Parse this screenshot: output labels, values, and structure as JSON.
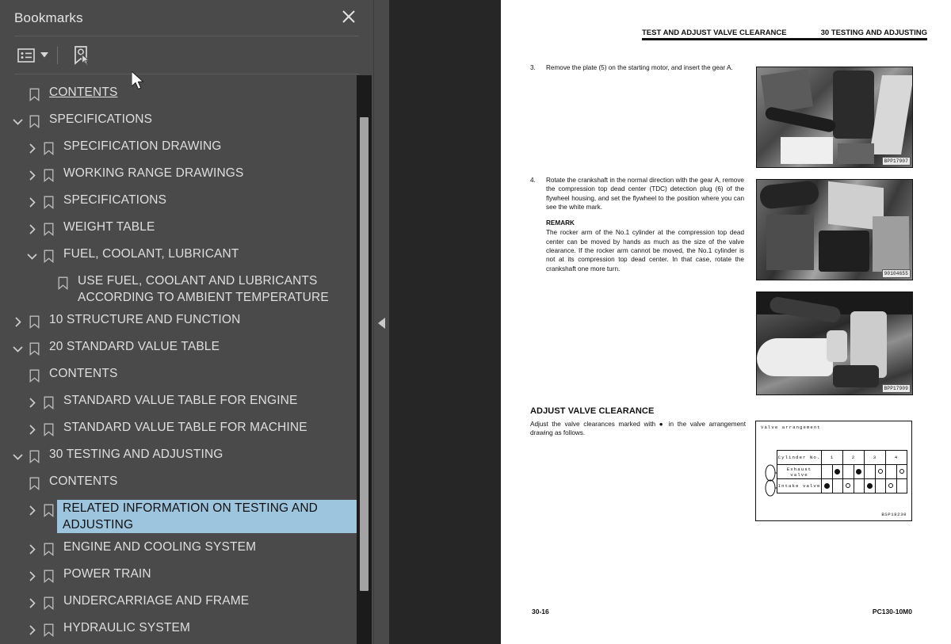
{
  "panel": {
    "title": "Bookmarks",
    "close_label": "Close",
    "toolbar": {
      "options_icon": "list-options-icon",
      "caret_icon": "chevron-down-icon",
      "new_bookmark_icon": "new-bookmark-icon"
    }
  },
  "tree": [
    {
      "label": "CONTENTS",
      "level": 1,
      "twisty": "none",
      "link": true,
      "selected": false
    },
    {
      "label": "SPECIFICATIONS",
      "level": 1,
      "twisty": "expanded",
      "link": false,
      "selected": false
    },
    {
      "label": "SPECIFICATION DRAWING",
      "level": 2,
      "twisty": "collapsed",
      "link": false,
      "selected": false
    },
    {
      "label": "WORKING RANGE DRAWINGS",
      "level": 2,
      "twisty": "collapsed",
      "link": false,
      "selected": false
    },
    {
      "label": "SPECIFICATIONS",
      "level": 2,
      "twisty": "collapsed",
      "link": false,
      "selected": false
    },
    {
      "label": "WEIGHT TABLE",
      "level": 2,
      "twisty": "collapsed",
      "link": false,
      "selected": false
    },
    {
      "label": "FUEL, COOLANT, LUBRICANT",
      "level": 2,
      "twisty": "expanded",
      "link": false,
      "selected": false
    },
    {
      "label": "USE FUEL, COOLANT AND LUBRICANTS ACCORDING TO AMBIENT TEMPERATURE",
      "level": 3,
      "twisty": "none",
      "link": false,
      "selected": false
    },
    {
      "label": "10 STRUCTURE AND FUNCTION",
      "level": 0,
      "twisty": "collapsed",
      "link": false,
      "selected": false
    },
    {
      "label": "20 STANDARD VALUE TABLE",
      "level": 0,
      "twisty": "expanded",
      "link": false,
      "selected": false
    },
    {
      "label": "CONTENTS",
      "level": 1,
      "twisty": "none",
      "link": false,
      "selected": false
    },
    {
      "label": "STANDARD VALUE TABLE FOR ENGINE",
      "level": 2,
      "twisty": "collapsed",
      "link": false,
      "selected": false
    },
    {
      "label": "STANDARD VALUE TABLE FOR MACHINE",
      "level": 2,
      "twisty": "collapsed",
      "link": false,
      "selected": false
    },
    {
      "label": "30 TESTING AND ADJUSTING",
      "level": 0,
      "twisty": "expanded",
      "link": false,
      "selected": false
    },
    {
      "label": "CONTENTS",
      "level": 1,
      "twisty": "none",
      "link": false,
      "selected": false
    },
    {
      "label": "RELATED INFORMATION ON TESTING AND ADJUSTING",
      "level": 2,
      "twisty": "collapsed",
      "link": false,
      "selected": true
    },
    {
      "label": "ENGINE AND COOLING SYSTEM",
      "level": 2,
      "twisty": "collapsed",
      "link": false,
      "selected": false
    },
    {
      "label": "POWER TRAIN",
      "level": 2,
      "twisty": "collapsed",
      "link": false,
      "selected": false
    },
    {
      "label": "UNDERCARRIAGE AND FRAME",
      "level": 2,
      "twisty": "collapsed",
      "link": false,
      "selected": false
    },
    {
      "label": "HYDRAULIC SYSTEM",
      "level": 2,
      "twisty": "collapsed",
      "link": false,
      "selected": false
    }
  ],
  "document": {
    "header_left": "TEST AND ADJUST VALVE CLEARANCE",
    "header_right": "30 TESTING AND ADJUSTING",
    "steps": [
      {
        "num": "3.",
        "text": "Remove the plate (5) on the starting motor, and insert the gear A."
      },
      {
        "num": "4.",
        "text": "Rotate the crankshaft in the normal direction with the gear A, remove the compression top dead center (TDC) detection plug (6) of the flywheel housing, and set the flywheel to the position where you can see the white mark.",
        "remark_heading": "REMARK",
        "remark_text": "The rocker arm of the No.1 cylinder at the compression top dead center can be moved by hands as much as the size of the valve clearance. If the rocker arm cannot be moved, the No.1 cylinder is not at its compression top dead center. In that case, rotate the crankshaft one more turn."
      }
    ],
    "figures": [
      {
        "caption": "BPP17907",
        "alt": "starting-motor-photo"
      },
      {
        "caption": "90104655",
        "alt": "flywheel-housing-photo"
      },
      {
        "caption": "BPP17909",
        "alt": "hand-rotating-crankshaft-photo"
      }
    ],
    "section": {
      "title": "ADJUST VALVE CLEARANCE",
      "body": "Adjust the valve clearances marked with ● in the valve arrangement drawing as follows."
    },
    "valve_figure": {
      "title": "Valve arrangement",
      "code": "BSP18230",
      "row_headers": [
        "Cylinder No.",
        "Exhaust valve",
        "Intake valve"
      ],
      "cylinders": [
        "1",
        "2",
        "3",
        "4"
      ],
      "exhaust": [
        "filled",
        "filled",
        "open",
        "open"
      ],
      "intake": [
        "filled",
        "open",
        "filled",
        "open"
      ],
      "exhaust_cells": [
        "empty",
        "filled",
        "empty",
        "filled",
        "empty",
        "open",
        "empty",
        "open"
      ],
      "intake_cells": [
        "filled",
        "empty",
        "open",
        "empty",
        "filled",
        "empty",
        "open",
        "empty"
      ]
    },
    "footer_left": "30-16",
    "footer_right": "PC130-10M0"
  },
  "colors": {
    "panel_bg": "#4a4a4a",
    "viewer_bg": "#262626",
    "selection": "#9dc5de",
    "scrollbar_thumb": "#a3a3a3",
    "scrollbar_track": "#1b1b1b"
  }
}
